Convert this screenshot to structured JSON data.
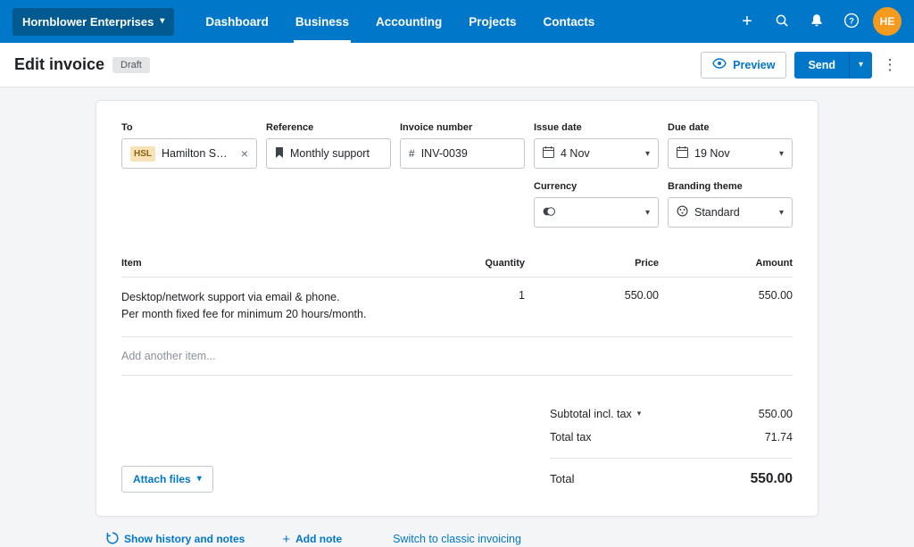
{
  "colors": {
    "brand_blue": "#0077C8",
    "org_button_bg": "#00598f",
    "avatar_bg": "#F49B1F",
    "page_bg": "#f4f5f7",
    "badge_bg": "#e3e5e7",
    "contact_badge_bg": "#f7e3b6"
  },
  "icons": {
    "chevron_down": "▾",
    "plus": "+",
    "kebab": "⋮",
    "close": "×",
    "hash": "#"
  },
  "header": {
    "org_name": "Hornblower Enterprises",
    "nav": [
      "Dashboard",
      "Business",
      "Accounting",
      "Projects",
      "Contacts"
    ],
    "avatar_initials": "HE"
  },
  "toolbar": {
    "title": "Edit invoice",
    "status_badge": "Draft",
    "preview_label": "Preview",
    "send_label": "Send"
  },
  "invoice": {
    "fields": {
      "to": {
        "label": "To",
        "badge": "HSL",
        "value": "Hamilton Smith Ltd"
      },
      "reference": {
        "label": "Reference",
        "value": "Monthly support"
      },
      "invoice_number": {
        "label": "Invoice number",
        "value": "INV-0039"
      },
      "issue_date": {
        "label": "Issue date",
        "value": "4 Nov"
      },
      "due_date": {
        "label": "Due date",
        "value": "19 Nov"
      },
      "currency": {
        "label": "Currency",
        "value": ""
      },
      "branding_theme": {
        "label": "Branding theme",
        "value": "Standard"
      }
    },
    "table": {
      "headers": [
        "Item",
        "Quantity",
        "Price",
        "Amount"
      ],
      "rows": [
        {
          "item_line1": "Desktop/network support via email & phone.",
          "item_line2": "Per month fixed fee for minimum 20 hours/month.",
          "quantity": "1",
          "price": "550.00",
          "amount": "550.00"
        }
      ],
      "add_item_placeholder": "Add another item..."
    },
    "totals": {
      "subtotal_label": "Subtotal incl. tax",
      "subtotal_value": "550.00",
      "tax_label": "Total tax",
      "tax_value": "71.74",
      "total_label": "Total",
      "total_value": "550.00"
    },
    "attach_files_label": "Attach files"
  },
  "footer": {
    "history_label": "Show history and notes",
    "add_note_label": "Add note",
    "switch_classic_label": "Switch to classic invoicing"
  }
}
